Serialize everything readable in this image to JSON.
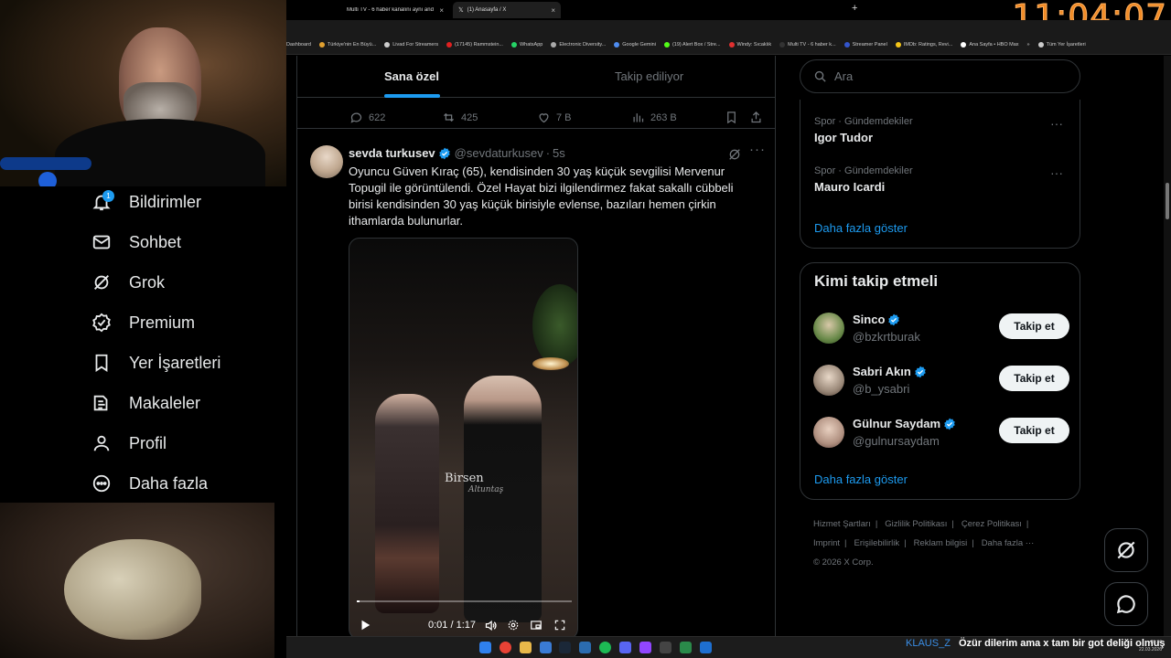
{
  "clock": "11:04:07",
  "browser": {
    "tabs": [
      {
        "title": "Multi TV - 6 haber kanalını aynı anda izle",
        "active": false
      },
      {
        "title": "(1) Anasayfa / X",
        "active": true
      }
    ],
    "new_tab": "+",
    "bookmarks": [
      {
        "label": "Dashboard",
        "color": "#888888"
      },
      {
        "label": "Türkiye'nin En Büyü...",
        "color": "#e0a030"
      },
      {
        "label": "Livad For Streamers",
        "color": "#cccccc"
      },
      {
        "label": "(17145) Rammstein...",
        "color": "#e02020"
      },
      {
        "label": "WhatsApp",
        "color": "#25d366"
      },
      {
        "label": "Electronic Diversity...",
        "color": "#aaaaaa"
      },
      {
        "label": "Google Gemini",
        "color": "#4e8cf0"
      },
      {
        "label": "(19) Alert Box / Stre...",
        "color": "#53fc18"
      },
      {
        "label": "Windy: Sıcaklık",
        "color": "#e03030"
      },
      {
        "label": "Multi TV - 6 haber k...",
        "color": "#333333"
      },
      {
        "label": "Streamer Panel",
        "color": "#3355cc"
      },
      {
        "label": "IMDb: Ratings, Revi...",
        "color": "#f5c518"
      },
      {
        "label": "Ana Sayfa • HBO Max",
        "color": "#ffffff"
      },
      {
        "label": "»",
        "color": "#000000"
      },
      {
        "label": "Tüm Yer İşaretleri",
        "color": "#cccccc"
      }
    ]
  },
  "nav": {
    "notifications_badge": "1",
    "items": [
      {
        "label": "Bildirimler",
        "icon": "bell-icon"
      },
      {
        "label": "Sohbet",
        "icon": "envelope-icon"
      },
      {
        "label": "Grok",
        "icon": "grok-icon"
      },
      {
        "label": "Premium",
        "icon": "verified-badge-icon"
      },
      {
        "label": "Yer İşaretleri",
        "icon": "bookmark-icon"
      },
      {
        "label": "Makaleler",
        "icon": "article-icon"
      },
      {
        "label": "Profil",
        "icon": "person-icon"
      },
      {
        "label": "Daha fazla",
        "icon": "more-circle-icon"
      }
    ]
  },
  "timeline": {
    "tabs": [
      "Sana özel",
      "Takip ediliyor"
    ],
    "prev_actions": {
      "replies": "622",
      "reposts": "425",
      "likes": "7 B",
      "views": "263 B"
    },
    "tweet": {
      "name": "sevda turkusev",
      "handle": "@sevdaturkusev",
      "dot": "·",
      "time": "5s",
      "more": "···",
      "text": "Oyuncu Güven Kıraç (65), kendisinden 30 yaş küçük sevgilisi Mervenur Topugil ile görüntülendi. Özel Hayat bizi ilgilendirmez fakat sakallı cübbeli birisi kendisinden 30 yaş küçük birisiyle evlense, bazıları hemen çirkin ithamlarda bulunurlar.",
      "video": {
        "time": "0:01 / 1:17",
        "progress": 0.013,
        "watermark": "Birsen",
        "watermark_script": "Altuntaş"
      }
    }
  },
  "right": {
    "search_placeholder": "Ara",
    "trends": [
      {
        "category": "Spor · Gündemdekiler",
        "title": "Igor Tudor"
      },
      {
        "category": "Spor · Gündemdekiler",
        "title": "Mauro Icardi"
      }
    ],
    "trends_show_more": "Daha fazla göster",
    "who_to_follow": {
      "title": "Kimi takip etmeli",
      "users": [
        {
          "name": "Sinco",
          "handle": "@bzkrtburak",
          "button": "Takip et"
        },
        {
          "name": "Sabri Akın",
          "handle": "@b_ysabri",
          "button": "Takip et"
        },
        {
          "name": "Gülnur Saydam",
          "handle": "@gulnursaydam",
          "button": "Takip et"
        }
      ],
      "show_more": "Daha fazla göster"
    },
    "footer": {
      "links": [
        "Hizmet Şartları",
        "Gizlilik Politikası",
        "Çerez Politikası",
        "Imprint",
        "Erişilebilirlik",
        "Reklam bilgisi",
        "Daha fazla ···"
      ],
      "separator": "|",
      "copyright": "© 2026 X Corp."
    }
  },
  "chat": {
    "user": "KLAUS_Z",
    "message": "Özür dilerim ama x tam bir got deliği olmuş"
  },
  "system_tray": {
    "time": "20:36",
    "date": "22.03.2026"
  }
}
